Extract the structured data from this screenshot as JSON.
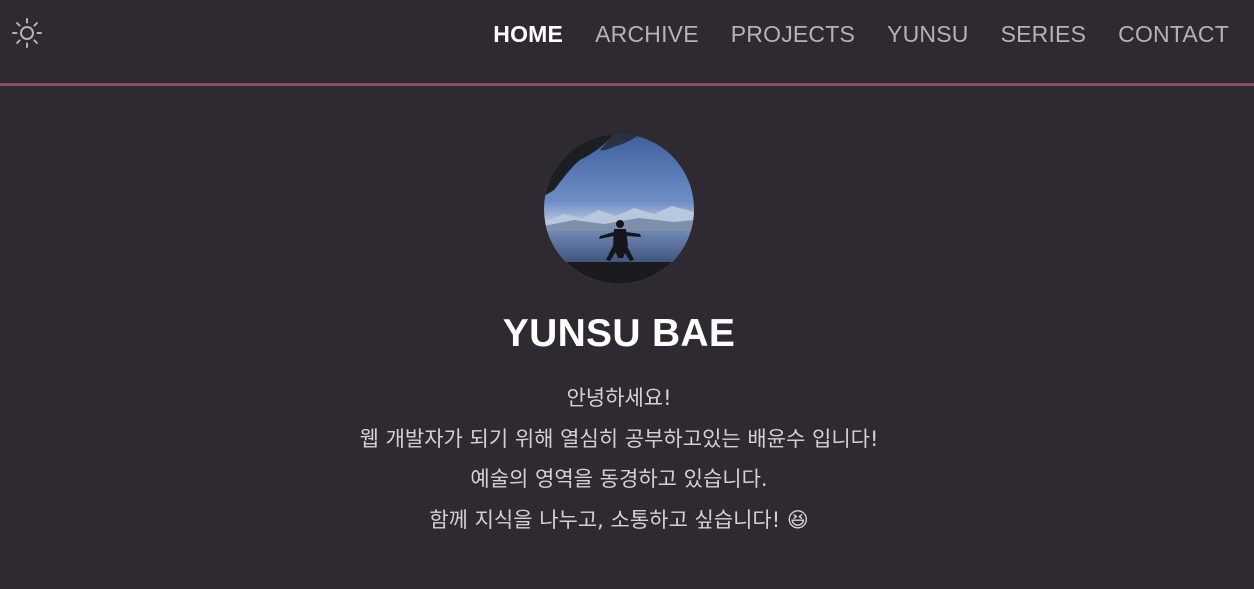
{
  "header": {
    "theme_toggle_icon": "sun-icon",
    "nav": [
      {
        "label": "HOME",
        "active": true
      },
      {
        "label": "ARCHIVE",
        "active": false
      },
      {
        "label": "PROJECTS",
        "active": false
      },
      {
        "label": "YUNSU",
        "active": false
      },
      {
        "label": "SERIES",
        "active": false
      },
      {
        "label": "CONTACT",
        "active": false
      }
    ]
  },
  "profile": {
    "avatar": "profile-photo",
    "name": "YUNSU BAE",
    "bio": [
      "안녕하세요!",
      "웹 개발자가 되기 위해 열심히 공부하고있는 배윤수 입니다!",
      "예술의 영역을 동경하고 있습니다.",
      "함께 지식을 나누고, 소통하고 싶습니다! 😆"
    ]
  },
  "colors": {
    "background": "#2f2a32",
    "divider": "#8a4c66",
    "nav_text": "#b6b1b9",
    "nav_active": "#ffffff",
    "bio_text": "#d5d0d8"
  }
}
